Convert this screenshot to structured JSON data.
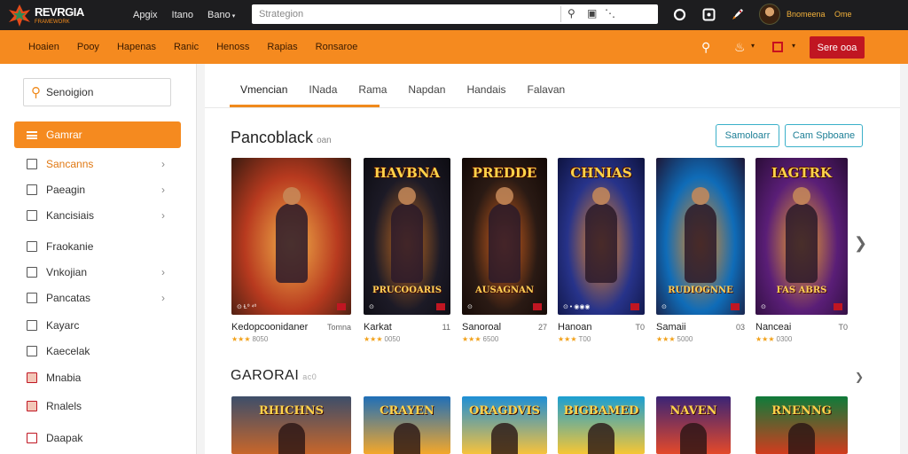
{
  "topbar": {
    "logo_title": "REVRGIA",
    "logo_sub": "FRAMEWORK",
    "nav": [
      "Apgix",
      "Itano",
      "Bano"
    ],
    "search_placeholder": "Strategion",
    "user_name": "Bnomeena",
    "user_sub": "Ome"
  },
  "catbar": {
    "items": [
      "Hoaien",
      "Pooy",
      "Hapenas",
      "Ranic",
      "Henoss",
      "Rapias",
      "Ronsaroe"
    ],
    "sign_label": "Sere ooa"
  },
  "sidebar": {
    "search_placeholder": "Senoigion",
    "active": "Gamrar",
    "items": [
      {
        "label": "Sancanns",
        "chevron": true,
        "orange": true
      },
      {
        "label": "Paeagin",
        "chevron": true
      },
      {
        "label": "Kancisiais",
        "chevron": true
      },
      {
        "label": "Fraokanie",
        "chevron": false
      },
      {
        "label": "Vnkojian",
        "chevron": true
      },
      {
        "label": "Pancatas",
        "chevron": true
      },
      {
        "label": "Kayarc",
        "chevron": false
      },
      {
        "label": "Kaecelak",
        "chevron": false
      },
      {
        "label": "Mnabia",
        "chevron": false
      },
      {
        "label": "Rnalels",
        "chevron": false
      },
      {
        "label": "Daapak",
        "chevron": false
      }
    ]
  },
  "main": {
    "tabs": [
      "Vmencian",
      "INada",
      "Rama",
      "Napdan",
      "Handais",
      "Falavan"
    ],
    "section1_title": "Pancoblack",
    "section1_sub": "oan",
    "btn_outline1": "Samoloarr",
    "btn_outline2": "Cam Spboane",
    "cards": [
      {
        "poster_title": "",
        "poster_sub": "",
        "foot": "⊙ Ɫ⁰ ⁴⁰",
        "name": "Kedopcoonidaner",
        "num": "Tomna",
        "score": "8050",
        "colors": [
          "#b83a1f",
          "#f2b14a",
          "#3a1b10"
        ]
      },
      {
        "poster_title": "HAVBNA",
        "poster_sub": "PRUCOOARIS",
        "foot": "⊙",
        "name": "Karkat",
        "num": "11",
        "score": "0050",
        "colors": [
          "#1c1a26",
          "#c26a1f",
          "#0d0c12"
        ]
      },
      {
        "poster_title": "PREDDE",
        "poster_sub": "AUSAGNAN",
        "foot": "⊙",
        "name": "Sanoroal",
        "num": "27",
        "score": "6500",
        "colors": [
          "#2a1a14",
          "#d5621d",
          "#120805"
        ]
      },
      {
        "poster_title": "CHNIAS",
        "poster_sub": "",
        "foot": "⊙ • ◉◉◉",
        "name": "Hanoan",
        "num": "T0",
        "score": "T00",
        "colors": [
          "#27338a",
          "#ef8b23",
          "#0e1340"
        ]
      },
      {
        "poster_title": "",
        "poster_sub": "RUDIOGNNE",
        "foot": "⊙",
        "name": "Samaii",
        "num": "03",
        "score": "5000",
        "colors": [
          "#0f6cb8",
          "#f08a1c",
          "#1d1636"
        ]
      },
      {
        "poster_title": "IAGTRK",
        "poster_sub": "FAS ABRS",
        "foot": "⊙",
        "name": "Nanceai",
        "num": "T0",
        "score": "0300",
        "colors": [
          "#5a1e77",
          "#f0a52a",
          "#2b0d38"
        ]
      }
    ],
    "section2_title": "GARORAI",
    "section2_sub": "ac0",
    "row2": [
      {
        "poster_title": "RHICHNS",
        "colors": [
          "#3d4e6a",
          "#c8662a"
        ]
      },
      {
        "poster_title": "CRAYEN",
        "colors": [
          "#1f6fb8",
          "#f4a72a"
        ]
      },
      {
        "poster_title": "ORAGDVIS",
        "colors": [
          "#1e8fd6",
          "#f7c23c"
        ]
      },
      {
        "poster_title": "BIGBAMED",
        "colors": [
          "#1b9fd2",
          "#f6c634"
        ]
      },
      {
        "poster_title": "NAVEN",
        "colors": [
          "#3a2476",
          "#e4492a"
        ]
      },
      {
        "poster_title": "RNENNG",
        "colors": [
          "#0f7b3a",
          "#d23c1e"
        ]
      }
    ]
  },
  "colors": {
    "accent": "#f58a1f",
    "danger": "#c01622",
    "teal": "#3bb0c9",
    "star": "#f2a11a"
  }
}
